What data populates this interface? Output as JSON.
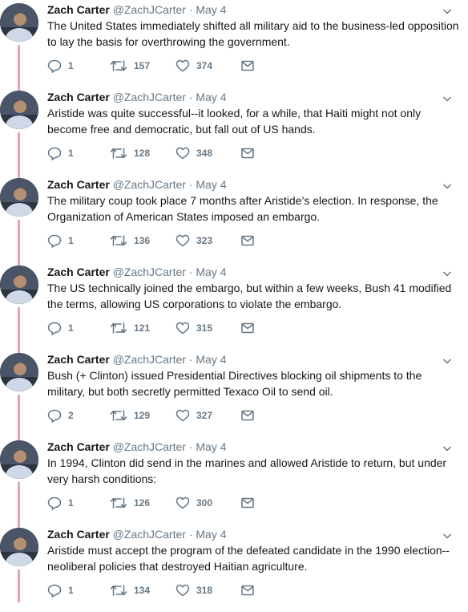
{
  "tweets": [
    {
      "name": "Zach Carter",
      "handle": "@ZachJCarter",
      "dot": "·",
      "date": "May 4",
      "text": "The United States immediately shifted all military aid to the business-led opposition to lay the basis for overthrowing the government.",
      "replies": "1",
      "retweets": "157",
      "likes": "374"
    },
    {
      "name": "Zach Carter",
      "handle": "@ZachJCarter",
      "dot": "·",
      "date": "May 4",
      "text": "Aristide was quite successful--it looked, for a while, that Haiti might not only become free and democratic, but fall out of US hands.",
      "replies": "1",
      "retweets": "128",
      "likes": "348"
    },
    {
      "name": "Zach Carter",
      "handle": "@ZachJCarter",
      "dot": "·",
      "date": "May 4",
      "text": "The military coup took place 7 months after Aristide’s election. In response, the Organization of American States imposed an embargo.",
      "replies": "1",
      "retweets": "136",
      "likes": "323"
    },
    {
      "name": "Zach Carter",
      "handle": "@ZachJCarter",
      "dot": "·",
      "date": "May 4",
      "text": "The US technically joined the embargo, but within a few weeks, Bush 41 modified the terms, allowing US corporations to violate the embargo.",
      "replies": "1",
      "retweets": "121",
      "likes": "315"
    },
    {
      "name": "Zach Carter",
      "handle": "@ZachJCarter",
      "dot": "·",
      "date": "May 4",
      "text": "Bush (+ Clinton) issued Presidential Directives blocking oil shipments to the military, but both secretly permitted Texaco Oil to send oil.",
      "replies": "2",
      "retweets": "129",
      "likes": "327"
    },
    {
      "name": "Zach Carter",
      "handle": "@ZachJCarter",
      "dot": "·",
      "date": "May 4",
      "text": "In 1994, Clinton did send in the marines and allowed Aristide to return, but under very harsh conditions:",
      "replies": "1",
      "retweets": "126",
      "likes": "300"
    },
    {
      "name": "Zach Carter",
      "handle": "@ZachJCarter",
      "dot": "·",
      "date": "May 4",
      "text": "Aristide must accept the program of the defeated candidate in the 1990 election--neoliberal policies that destroyed Haitian agriculture.",
      "replies": "1",
      "retweets": "134",
      "likes": "318"
    }
  ],
  "colors": {
    "thread_line": "#e1a3bd",
    "secondary_text": "#657786",
    "primary_text": "#14171a"
  },
  "icons": {
    "reply": "reply-icon",
    "retweet": "retweet-icon",
    "like": "heart-icon",
    "message": "envelope-icon",
    "caret": "chevron-down-icon"
  }
}
